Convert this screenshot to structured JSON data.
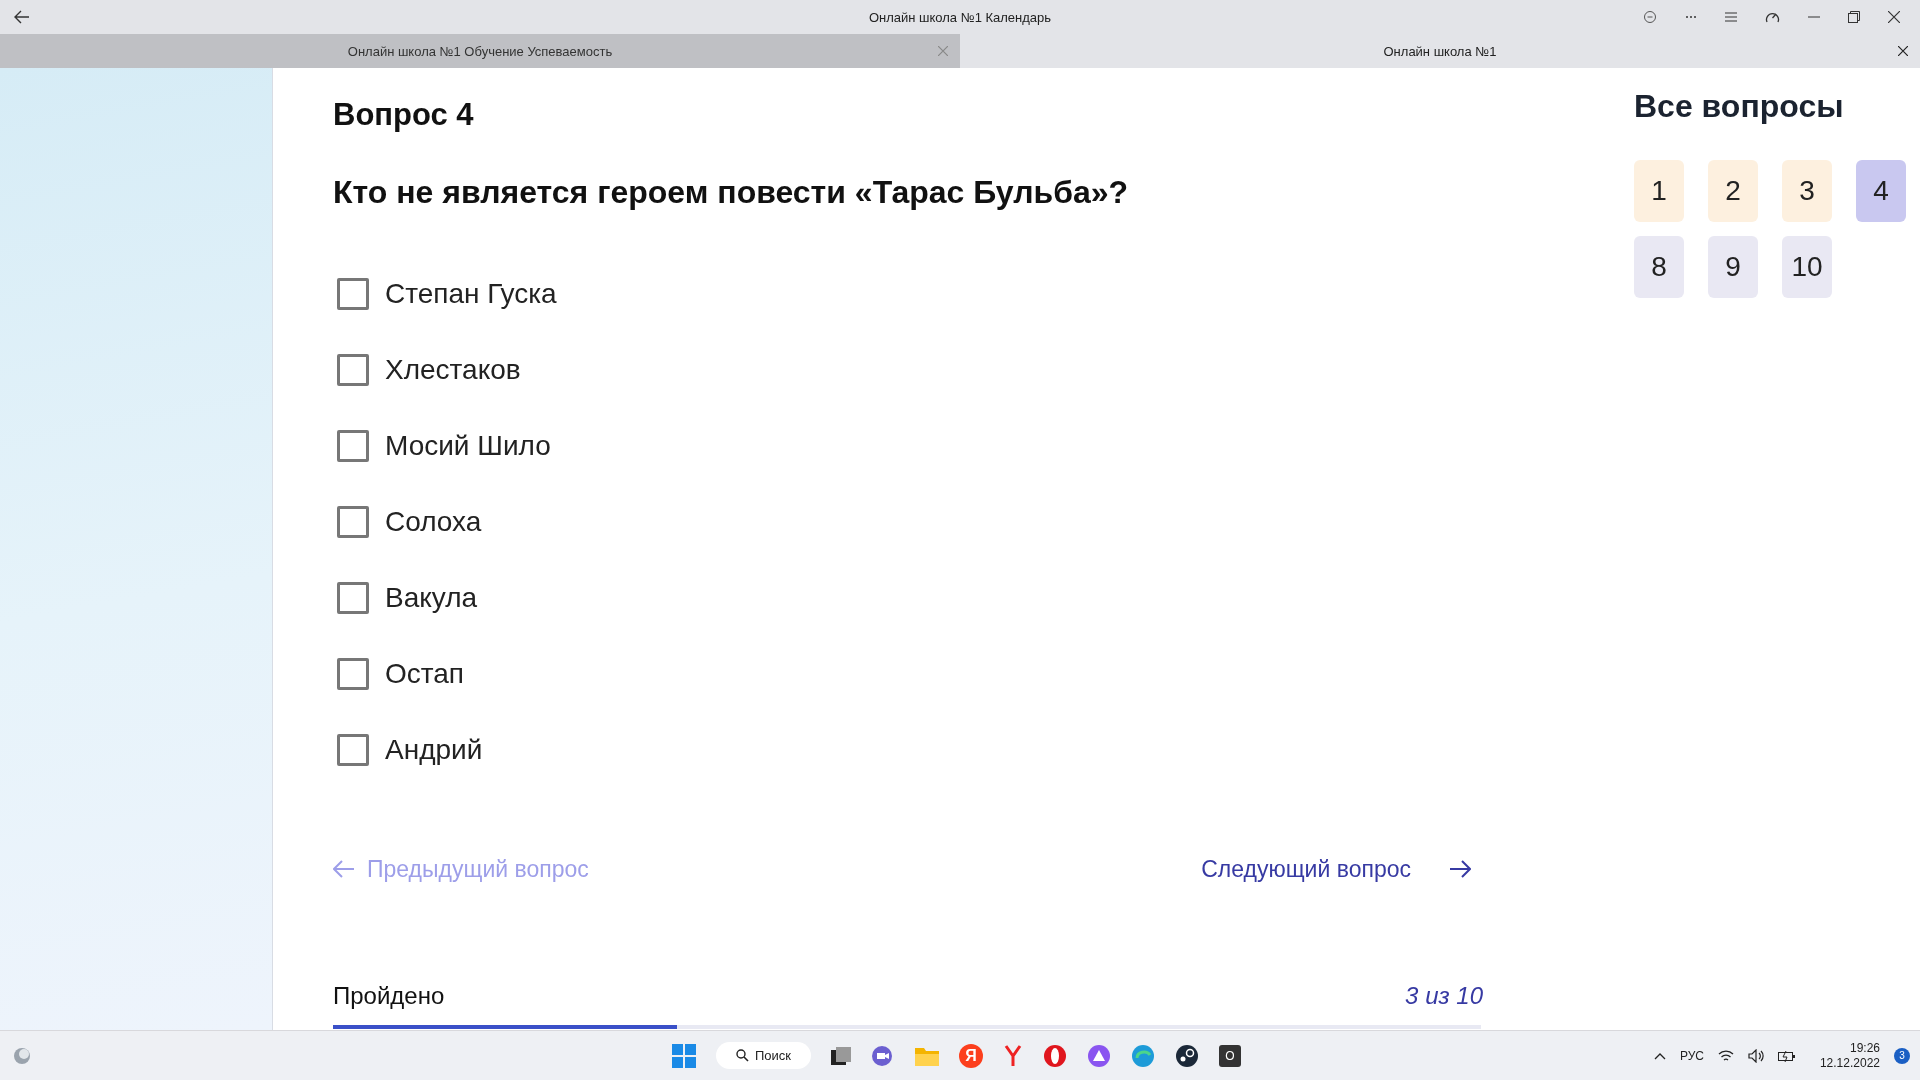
{
  "window": {
    "title": "Онлайн школа №1 Календарь"
  },
  "tabs": [
    {
      "label": "Онлайн школа №1 Обучение Успеваемость",
      "selected": false
    },
    {
      "label": "Онлайн школа №1",
      "selected": true
    }
  ],
  "question": {
    "number_label": "Вопрос 4",
    "text": "Кто не является героем повести «Тарас Бульба»?",
    "options": [
      {
        "label": "Степан Гуска",
        "checked": false
      },
      {
        "label": "Хлестаков",
        "checked": false
      },
      {
        "label": "Мосий Шило",
        "checked": false
      },
      {
        "label": "Солоха",
        "checked": false
      },
      {
        "label": "Вакула",
        "checked": false
      },
      {
        "label": "Остап",
        "checked": false
      },
      {
        "label": "Андрий",
        "checked": false
      }
    ]
  },
  "navigation": [
    {
      "kind": "prev",
      "label": "Предыдущий вопрос"
    },
    {
      "kind": "next",
      "label": "Следующий вопрос"
    }
  ],
  "progress": {
    "label": "Пройдено",
    "count": "3 из 10",
    "level": 0.3
  },
  "all_questions": {
    "title": "Все вопросы",
    "items": [
      {
        "label": "1",
        "answered": true,
        "selected": false
      },
      {
        "label": "2",
        "answered": true,
        "selected": false
      },
      {
        "label": "3",
        "answered": true,
        "selected": false
      },
      {
        "label": "4",
        "answered": false,
        "selected": true
      },
      {
        "label": "8",
        "answered": false,
        "selected": false
      },
      {
        "label": "9",
        "answered": false,
        "selected": false
      },
      {
        "label": "10",
        "answered": false,
        "selected": false
      }
    ]
  },
  "taskbar": {
    "search": "Поиск",
    "yandex_letter": "Я",
    "app_letter": "O",
    "language": "РУС",
    "time": "19:26",
    "date": "12.12.2022",
    "notifications": "3"
  }
}
